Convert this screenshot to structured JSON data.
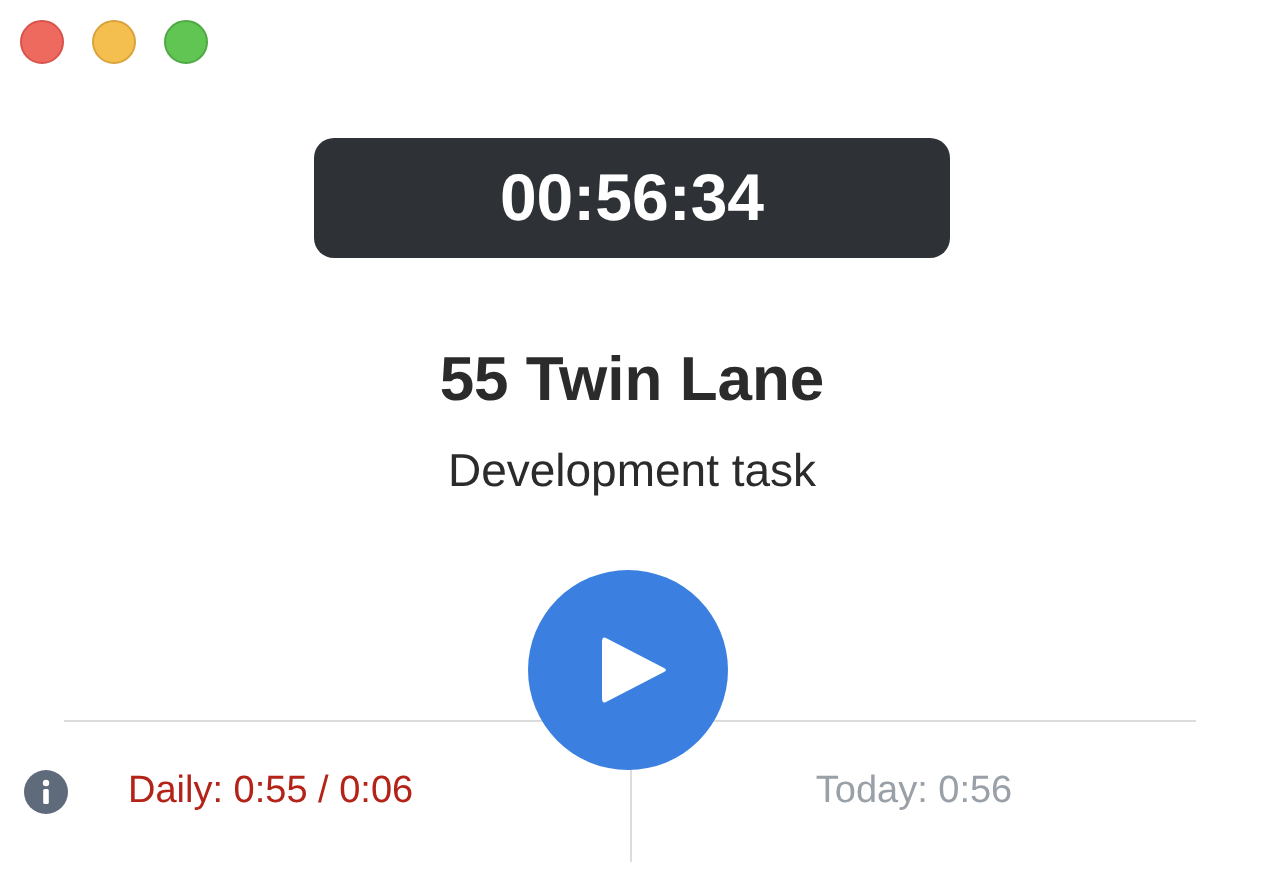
{
  "timer": "00:56:34",
  "title": "55 Twin Lane",
  "subtitle": "Development task",
  "footer": {
    "daily": "Daily: 0:55 / 0:06",
    "today": "Today: 0:56"
  }
}
